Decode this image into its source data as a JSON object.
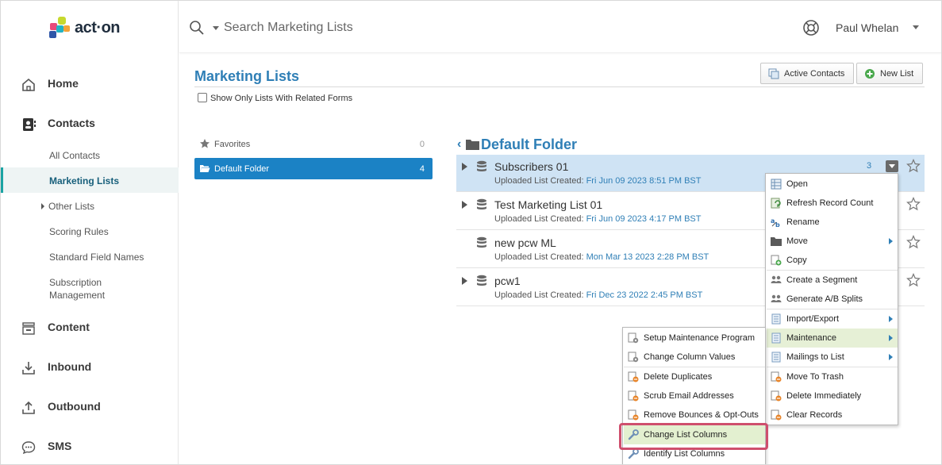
{
  "brand": {
    "logo_text": "act·on",
    "colors": {
      "accent": "#2f7fb6",
      "selected": "#1b82c5",
      "teal": "#1aa3a3",
      "highlight_frame": "#cf4f6d"
    }
  },
  "sidebar": {
    "main": [
      {
        "label": "Home",
        "icon": "home-icon"
      },
      {
        "label": "Contacts",
        "icon": "contacts-icon"
      },
      {
        "label": "Content",
        "icon": "content-icon"
      },
      {
        "label": "Inbound",
        "icon": "inbound-icon"
      },
      {
        "label": "Outbound",
        "icon": "outbound-icon"
      },
      {
        "label": "SMS",
        "icon": "sms-icon"
      }
    ],
    "contacts_sub": [
      {
        "label": "All Contacts"
      },
      {
        "label": "Marketing Lists"
      },
      {
        "label": "Other Lists"
      },
      {
        "label": "Scoring Rules"
      },
      {
        "label": "Standard Field Names"
      },
      {
        "label": "Subscription Management"
      }
    ]
  },
  "topbar": {
    "search_placeholder": "Search Marketing Lists",
    "user_name": "Paul Whelan"
  },
  "main": {
    "title": "Marketing Lists",
    "buttons": {
      "active_contacts": "Active Contacts",
      "new_list": "New List"
    },
    "filter_label": "Show Only Lists With Related Forms",
    "folders": [
      {
        "label": "Favorites",
        "count": "0"
      },
      {
        "label": "Default Folder",
        "count": "4"
      }
    ],
    "current_folder": "Default Folder",
    "lists": [
      {
        "name": "Subscribers 01",
        "meta_prefix": "Uploaded List Created:",
        "date": "Fri Jun 09 2023 8:51 PM BST",
        "count": "3"
      },
      {
        "name": "Test Marketing List 01",
        "meta_prefix": "Uploaded List Created:",
        "date": "Fri Jun 09 2023 4:17 PM BST"
      },
      {
        "name": "new pcw ML",
        "meta_prefix": "Uploaded List Created:",
        "date": "Mon Mar 13 2023 2:28 PM BST"
      },
      {
        "name": "pcw1",
        "meta_prefix": "Uploaded List Created:",
        "date": "Fri Dec 23 2022 2:45 PM BST"
      }
    ]
  },
  "context_menu": {
    "items": [
      {
        "label": "Open"
      },
      {
        "label": "Refresh Record Count"
      },
      {
        "label": "Rename"
      },
      {
        "label": "Move"
      },
      {
        "label": "Copy"
      },
      {
        "label": "Create a Segment"
      },
      {
        "label": "Generate A/B Splits"
      },
      {
        "label": "Import/Export"
      },
      {
        "label": "Maintenance"
      },
      {
        "label": "Mailings to List"
      },
      {
        "label": "Move To Trash"
      },
      {
        "label": "Delete Immediately"
      },
      {
        "label": "Clear Records"
      }
    ]
  },
  "maintenance_submenu": {
    "items": [
      {
        "label": "Setup Maintenance Program"
      },
      {
        "label": "Change Column Values"
      },
      {
        "label": "Delete Duplicates"
      },
      {
        "label": "Scrub Email Addresses"
      },
      {
        "label": "Remove Bounces & Opt-Outs"
      },
      {
        "label": "Change List Columns"
      },
      {
        "label": "Identify List Columns"
      }
    ]
  }
}
